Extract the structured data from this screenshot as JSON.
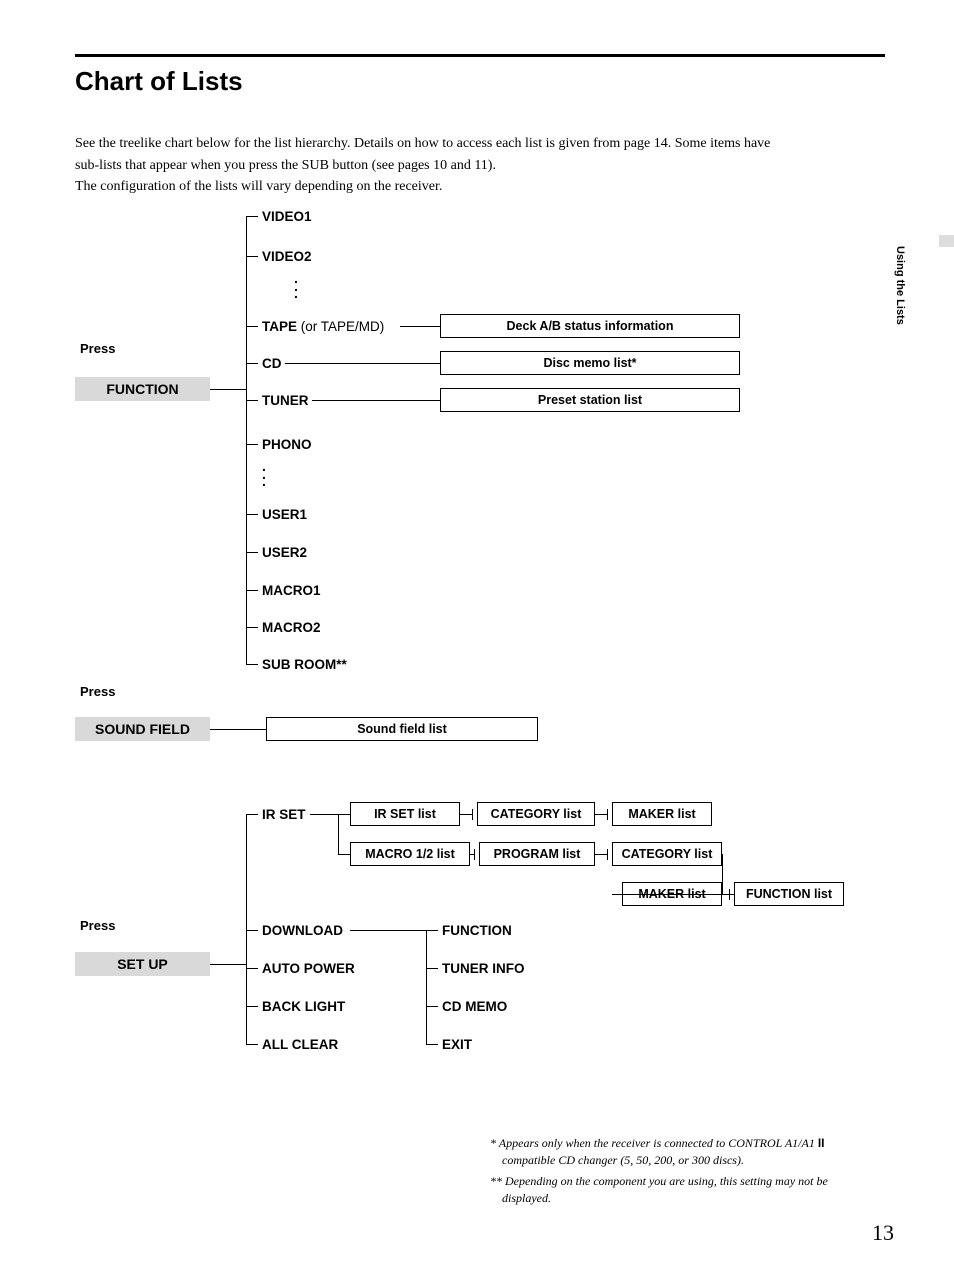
{
  "title": "Chart of Lists",
  "intro_l1": "See the treelike chart below for the list hierarchy.  Details on how to access each list is given from page 14.  Some items have",
  "intro_l2": "sub-lists that appear when you press the SUB button (see pages 10 and 11).",
  "intro_l3": "The configuration of the lists will vary depending on the receiver.",
  "sidetab": "Using the Lists",
  "press": "Press",
  "buttons": {
    "function": "FUNCTION",
    "soundfield": "SOUND FIELD",
    "setup": "SET UP"
  },
  "func": {
    "video1": "VIDEO1",
    "video2": "VIDEO2",
    "tape": "TAPE",
    "tape_extra": " (or TAPE/MD)",
    "cd": "CD",
    "tuner": "TUNER",
    "phono": "PHONO",
    "user1": "USER1",
    "user2": "USER2",
    "macro1": "MACRO1",
    "macro2": "MACRO2",
    "subroom": "SUB ROOM**"
  },
  "boxes": {
    "deck": "Deck A/B status information",
    "disc": "Disc memo list*",
    "preset": "Preset station list",
    "sfl": "Sound field list",
    "irset": "IR SET list",
    "macro12": "MACRO 1/2 list",
    "category": "CATEGORY list",
    "program": "PROGRAM list",
    "maker": "MAKER list",
    "category2": "CATEGORY list",
    "maker2": "MAKER list",
    "funclist": "FUNCTION list"
  },
  "setup": {
    "irset": "IR SET",
    "download": "DOWNLOAD",
    "autopower": "AUTO POWER",
    "backlight": "BACK LIGHT",
    "allclear": "ALL CLEAR",
    "dl_function": "FUNCTION",
    "tunerinfo": "TUNER INFO",
    "cdmemo": "CD MEMO",
    "exit": "EXIT"
  },
  "footnotes": {
    "f1a": "*   Appears only when the receiver is connected to CONTROL A1/A1 ",
    "f1b": "II",
    "f1c": "compatible CD changer (5, 50, 200, or 300 discs).",
    "f2a": "** Depending on the component you are using, this setting may not be",
    "f2b": "displayed."
  },
  "pagenum": "13"
}
